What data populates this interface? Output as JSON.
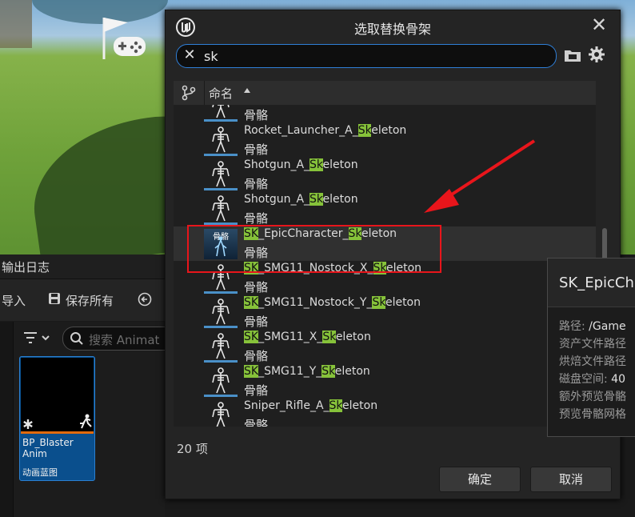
{
  "background": {
    "output_log_title": "输出日志",
    "toolbar": {
      "import_label": "导入",
      "save_all_label": "保存所有"
    },
    "search": {
      "placeholder": "搜索 Animat"
    },
    "asset": {
      "name_line1": "BP_Blaster",
      "name_line2": "Anim",
      "type": "动画蓝图"
    }
  },
  "dialog": {
    "title": "选取替换骨架",
    "search_value": "sk",
    "column_name": "命名",
    "items": [
      {
        "name_pre": "",
        "name_hl": "",
        "name_post": "",
        "type": "骨骼"
      },
      {
        "name_pre": "Rocket_Launcher_A_",
        "name_hl": "Sk",
        "name_post": "eleton",
        "type": "骨骼"
      },
      {
        "name_pre": "Shotgun_A_",
        "name_hl": "Sk",
        "name_post": "eleton",
        "type": "骨骼"
      },
      {
        "name_pre": "Shotgun_A_",
        "name_hl": "Sk",
        "name_post": "eleton",
        "type": "骨骼"
      },
      {
        "name_pre": "",
        "name_hl": "SK",
        "name_mid": "_EpicCharacter_",
        "name_hl2": "Sk",
        "name_post": "eleton",
        "type": "骨骼",
        "thumb_label": "骨骼",
        "selected": true
      },
      {
        "name_pre": "",
        "name_hl": "SK",
        "name_mid": "_SMG11_Nostock_X_",
        "name_hl2": "Sk",
        "name_post": "eleton",
        "type": "骨骼"
      },
      {
        "name_pre": "",
        "name_hl": "SK",
        "name_mid": "_SMG11_Nostock_Y_",
        "name_hl2": "Sk",
        "name_post": "eleton",
        "type": "骨骼"
      },
      {
        "name_pre": "",
        "name_hl": "SK",
        "name_mid": "_SMG11_X_",
        "name_hl2": "Sk",
        "name_post": "eleton",
        "type": "骨骼"
      },
      {
        "name_pre": "",
        "name_hl": "SK",
        "name_mid": "_SMG11_Y_",
        "name_hl2": "Sk",
        "name_post": "eleton",
        "type": "骨骼"
      },
      {
        "name_pre": "Sniper_Rifle_A_",
        "name_hl": "Sk",
        "name_post": "eleton",
        "type": "骨骼"
      }
    ],
    "count_label": "20 项",
    "ok_label": "确定",
    "cancel_label": "取消"
  },
  "tooltip": {
    "title": "SK_EpicCh",
    "lines": [
      {
        "label": "路径: ",
        "value": "/Game"
      },
      {
        "label": "资产文件路径",
        "value": ""
      },
      {
        "label": "烘焙文件路径",
        "value": ""
      },
      {
        "label": "磁盘空间: ",
        "value": "40"
      },
      {
        "label": "额外预览骨骼",
        "value": ""
      },
      {
        "label": "预览骨骼网格",
        "value": ""
      }
    ]
  },
  "colors": {
    "highlight": "#86c23a",
    "accent": "#2f7fd8",
    "annotation": "#e8151b",
    "selection_bar": "#4a90c8"
  }
}
